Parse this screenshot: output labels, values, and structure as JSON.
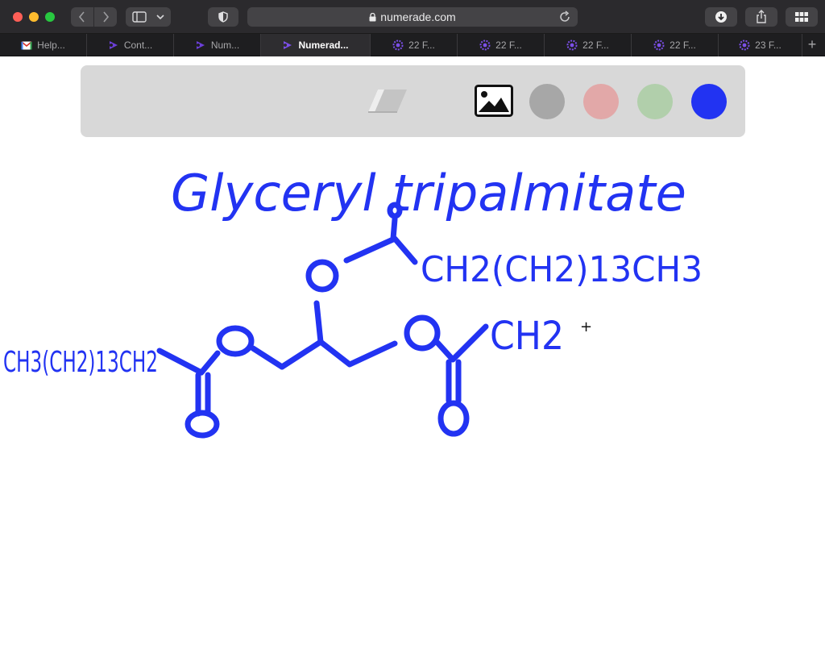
{
  "browser": {
    "url": "numerade.com",
    "tabs": [
      {
        "label": "Help...",
        "icon": "gmail-icon"
      },
      {
        "label": "Cont...",
        "icon": "numerade-icon"
      },
      {
        "label": "Num...",
        "icon": "numerade-icon"
      },
      {
        "label": "Numerad...",
        "icon": "numerade-icon",
        "active": true
      },
      {
        "label": "22 F...",
        "icon": "flower-icon"
      },
      {
        "label": "22 F...",
        "icon": "flower-icon"
      },
      {
        "label": "22 F...",
        "icon": "flower-icon"
      },
      {
        "label": "22 F...",
        "icon": "flower-icon"
      },
      {
        "label": "23 F...",
        "icon": "flower-icon"
      }
    ],
    "add_tab_label": "+"
  },
  "palette": {
    "tools": [
      "eraser-icon",
      "image-icon"
    ],
    "colors": [
      "#a7a7a7",
      "#e2a8a8",
      "#b1cfab",
      "#2233f2"
    ],
    "selected_color": "#2233f2"
  },
  "drawing": {
    "ink_color": "#2233f2",
    "title": "Glyceryl tripalmitate",
    "top_chain": "CH2(CH2)13CH3",
    "left_chain": "CH3(CH2)13CH2",
    "right_chain": "CH2",
    "oxygen": "O"
  }
}
